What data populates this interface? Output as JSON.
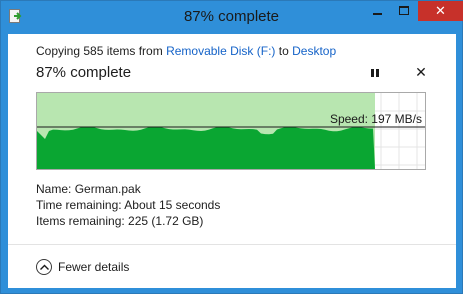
{
  "window": {
    "title": "87% complete",
    "close_glyph": "✕"
  },
  "dialog": {
    "copy_prefix": "Copying 585 items from ",
    "source": "Removable Disk (F:)",
    "copy_mid": " to ",
    "destination": "Desktop",
    "progress_text": "87% complete",
    "progress_fraction": 0.87,
    "cancel_glyph": "✕",
    "speed": "Speed: 197 MB/s",
    "details": {
      "name_label": "Name:",
      "name_value": "German.pak",
      "time_label": "Time remaining:",
      "time_value": "About 15 seconds",
      "items_label": "Items remaining:",
      "items_value": "225 (1.72 GB)"
    },
    "fewer_details": "Fewer details"
  },
  "colors": {
    "accent_border": "#2f8fd9",
    "graph_light": "#b8e6b0",
    "graph_dark": "#0aa632",
    "link": "#1563c8"
  },
  "icons": [
    "copy-icon",
    "minimize-icon",
    "maximize-icon",
    "close-icon",
    "pause-icon",
    "cancel-icon",
    "chevron-up-icon"
  ]
}
